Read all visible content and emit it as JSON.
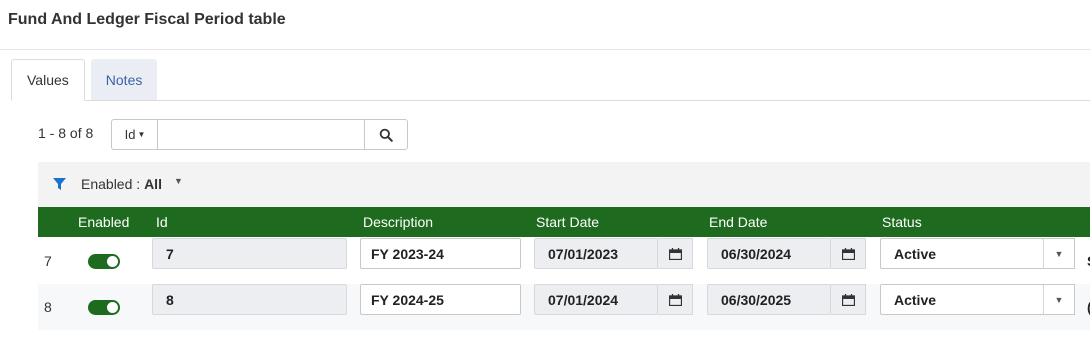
{
  "page": {
    "title": "Fund And Ledger Fiscal Period table"
  },
  "tabs": [
    {
      "label": "Values",
      "active": true
    },
    {
      "label": "Notes",
      "active": false
    }
  ],
  "toolbar": {
    "pager_text": "1 - 8 of 8",
    "search_field": "Id",
    "search_value": "",
    "search_icon": "magnifier-icon"
  },
  "filter": {
    "icon": "funnel-icon",
    "label": "Enabled :",
    "value": "All"
  },
  "table": {
    "columns": [
      "Enabled",
      "Id",
      "Description",
      "Start Date",
      "End Date",
      "Status"
    ],
    "rows": [
      {
        "num": "7",
        "enabled": true,
        "id": "7",
        "description": "FY 2023-24",
        "start_date": "07/01/2023",
        "end_date": "06/30/2024",
        "status": "Active",
        "overflow": "S"
      },
      {
        "num": "8",
        "enabled": true,
        "id": "8",
        "description": "FY 2024-25",
        "start_date": "07/01/2024",
        "end_date": "06/30/2025",
        "status": "Active",
        "overflow": "("
      }
    ]
  },
  "colors": {
    "header_green": "#1e6a1e",
    "tab_link": "#3b64a8",
    "filter_icon": "#1a73c9"
  }
}
